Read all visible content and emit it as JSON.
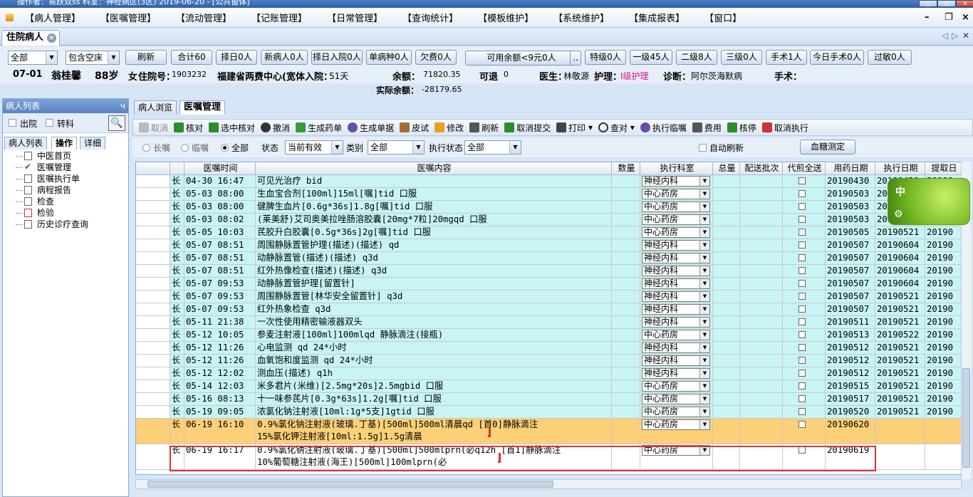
{
  "window_title": "操作者：易跃双ss  科室：神经病区(3区)  2019-06-20 - [公共窗体]",
  "menu": [
    "【病人管理】",
    "【医嘱管理】",
    "【流动管理】",
    "【记账管理】",
    "【日常管理】",
    "【查询统计】",
    "【模板维护】",
    "【系统维护】",
    "【集成报表】",
    "【窗口】"
  ],
  "doc_tab": "住院病人",
  "filters": {
    "scope": "全部",
    "bed": "包含空床",
    "buttons": [
      "刷新",
      "合计60",
      "择日0人",
      "新病人0人",
      "择日入院0人",
      "单病种0人",
      "欠费0人"
    ],
    "balance_btn": "可用余额<9元0人",
    "more_btn": "..",
    "buttons2": [
      "特级0人",
      "一级45人",
      "二级8人",
      "三级0人",
      "手术1人",
      "今日手术0人",
      "过敏0人"
    ]
  },
  "patient": {
    "bed": "07-01",
    "name": "翁桂馨",
    "age": "88岁",
    "sex": "女",
    "inpatient_label": "住院号：",
    "inpatient_no": "1903232",
    "hospital": "福建省两费中心(宽体入院：",
    "stay_days": "51天",
    "balance_label": "余额：",
    "balance": "71820.35",
    "avail_label": "可退",
    "avail": "0",
    "doctor_label": "医生：",
    "doctor": "林敬源",
    "nurse_label": "护理：",
    "nurse": "Ⅰ级护理",
    "diag_label": "诊断：",
    "diagnosis": "阿尔茨海默病",
    "surgery_label": "手术：",
    "actual_label": "实际余额：",
    "actual_balance": "-28179.65"
  },
  "left": {
    "title": "病人列表",
    "pin": "ч",
    "discharged": "出院",
    "transfer": "转科",
    "tabs": [
      "病人列表",
      "操作",
      "详细"
    ],
    "tree": [
      "中医首页",
      "医嘱管理",
      "医嘱执行单",
      "病程报告",
      "检查",
      "检验",
      "历史诊疗查询"
    ]
  },
  "main_tabs": [
    "病人浏览",
    "医嘱管理"
  ],
  "toolbar": [
    "取消",
    "核对",
    "选中核对",
    "撤消",
    "生成药单",
    "生成单据",
    "皮试",
    "修改",
    "刷新",
    "取消提交",
    "打印",
    "查对",
    "执行临嘱",
    "费用",
    "核停",
    "取消执行"
  ],
  "options": {
    "long": "长嘱",
    "temp": "临嘱",
    "all": "全部",
    "status_label": "状态",
    "status": "当前有效",
    "category_label": "类别",
    "category": "全部",
    "exec_label": "执行状态",
    "exec": "全部",
    "auto_refresh": "自动刷新",
    "glucose_btn": "血糖测定"
  },
  "columns": [
    "医嘱时间",
    "医嘱内容",
    "数量",
    "执行科室",
    "总量",
    "配送批次",
    "代煎全送",
    "用药日期",
    "执行日期",
    "提取日"
  ],
  "rows": [
    {
      "type": "长",
      "time": "04-30 16:47",
      "content": "可见光治疗 bid",
      "dept": "神经内科",
      "date": "20190430",
      "exec": "20190430",
      "ext": "20190"
    },
    {
      "type": "长",
      "time": "05-03 08:00",
      "content": "生血宝合剂[100ml]15ml[嘱]tid 口服",
      "dept": "中心药房",
      "date": "20190503",
      "exec": "20190521",
      "ext": "20190"
    },
    {
      "type": "长",
      "time": "05-03 08:00",
      "content": "健脾生血片[0.6g*36s]1.8g[嘱]tid 口服",
      "dept": "中心药房",
      "date": "20190503",
      "exec": "20190521",
      "ext": "20190"
    },
    {
      "type": "长",
      "time": "05-03 08:02",
      "content": "(莱美舒)艾司奥美拉唑肠溶胶囊[20mg*7粒]20mgqd 口服",
      "dept": "中心药房",
      "date": "20190503",
      "exec": "20190521",
      "ext": "20190"
    },
    {
      "type": "长",
      "time": "05-05 10:03",
      "content": "芪胶升白胶囊[0.5g*36s]2g[嘱]tid 口服",
      "dept": "中心药房",
      "date": "20190505",
      "exec": "20190521",
      "ext": "20190"
    },
    {
      "type": "长",
      "time": "05-07 08:51",
      "content": "周围静脉置管护理(描述)(描述) qd",
      "dept": "神经内科",
      "date": "20190507",
      "exec": "20190604",
      "ext": "20190"
    },
    {
      "type": "长",
      "time": "05-07 08:51",
      "content": "动静脉置管(描述)(描述) q3d",
      "dept": "神经内科",
      "date": "20190507",
      "exec": "20190604",
      "ext": "20190"
    },
    {
      "type": "长",
      "time": "05-07 08:51",
      "content": "红外热像检查(描述)(描述) q3d",
      "dept": "神经内科",
      "date": "20190507",
      "exec": "20190604",
      "ext": "20190"
    },
    {
      "type": "长",
      "time": "05-07 09:53",
      "content": "动静脉置管护理[留置针]",
      "dept": "神经内科",
      "date": "20190507",
      "exec": "20190604",
      "ext": "20190"
    },
    {
      "type": "长",
      "time": "05-07 09:53",
      "content": "周围静脉置管[林华安全留置针] q3d",
      "dept": "神经内科",
      "date": "20190507",
      "exec": "20190521",
      "ext": "20190"
    },
    {
      "type": "长",
      "time": "05-07 09:53",
      "content": "红外热象检查 q3d",
      "dept": "神经内科",
      "date": "20190507",
      "exec": "20190521",
      "ext": "20190"
    },
    {
      "type": "长",
      "time": "05-11 21:38",
      "content": "一次性使用精密输液器双头",
      "dept": "神经内科",
      "date": "20190511",
      "exec": "20190521",
      "ext": "20190"
    },
    {
      "type": "长",
      "time": "05-12 10:05",
      "content": "参麦注射液[100ml]100mlqd 静脉滴注(接瓶)",
      "dept": "中心药房",
      "date": "20190513",
      "exec": "20190522",
      "ext": "20190"
    },
    {
      "type": "长",
      "time": "05-12 11:26",
      "content": "心电监测 qd 24*小时",
      "dept": "神经内科",
      "date": "20190512",
      "exec": "20190521",
      "ext": "20190"
    },
    {
      "type": "长",
      "time": "05-12 11:26",
      "content": "血氧饱和度监测 qd 24*小时",
      "dept": "神经内科",
      "date": "20190512",
      "exec": "20190521",
      "ext": "20190"
    },
    {
      "type": "长",
      "time": "05-12 12:02",
      "content": "测血压(描述) q1h",
      "dept": "神经内科",
      "date": "20190512",
      "exec": "20190521",
      "ext": "20190"
    },
    {
      "type": "长",
      "time": "05-14 12:03",
      "content": "米多君片(米维)[2.5mg*20s]2.5mgbid 口服",
      "dept": "中心药房",
      "date": "20190515",
      "exec": "20190521",
      "ext": "20190"
    },
    {
      "type": "长",
      "time": "05-16 08:13",
      "content": "十一味参芪片[0.3g*63s]1.2g[嘱]tid 口服",
      "dept": "中心药房",
      "date": "20190517",
      "exec": "20190521",
      "ext": "20190"
    },
    {
      "type": "长",
      "time": "05-19 09:05",
      "content": "浓氯化钠注射液[10ml:1g*5支]1gtid 口服",
      "dept": "中心药房",
      "date": "20190520",
      "exec": "20190521",
      "ext": "20190"
    }
  ],
  "row_orange": {
    "type": "长",
    "time": "06-19 16:10",
    "content": "0.9%氯化钠注射液(玻璃.丁基)[500ml]500ml清晨qd [首0]静脉滴注",
    "content2": "15%氯化钾注射液[10ml:1.5g]1.5g清晨",
    "dept": "中心药房",
    "date": "20190620"
  },
  "row_white": {
    "type": "长",
    "time": "06-19 16:17",
    "content": "0.9%氯化钠注射液(玻璃.丁基)[500ml]500mlprn(必q12h [首1]静脉滴注",
    "content2": "10%葡萄糖注射液(海王)[500ml]100mlprn(必",
    "dept": "中心药房",
    "date": "20190619"
  },
  "widget_label": "中",
  "colors": {
    "row_cyan": "#c8f4f4",
    "row_orange": "#fbd078",
    "highlight": "#e53030",
    "accent": "#2b5ea8"
  }
}
